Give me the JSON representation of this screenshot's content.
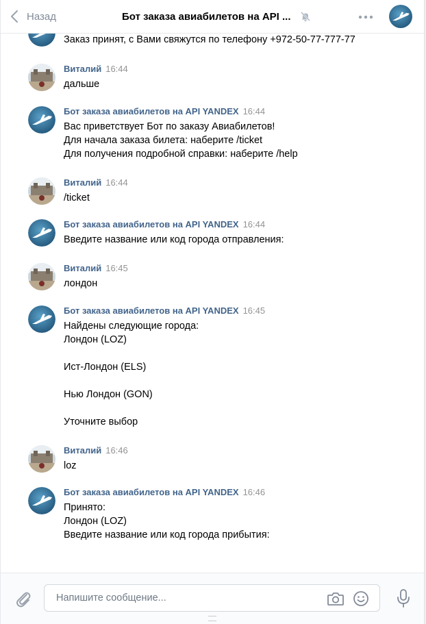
{
  "header": {
    "back_label": "Назад",
    "title": "Бот заказа авиабилетов на API ..."
  },
  "prev_message_tail": "Заказ принят, с Вами свяжутся по телефону +972-50-77-777-77",
  "messages": [
    {
      "author": "Виталий",
      "time": "16:44",
      "text": "дальше",
      "kind": "user"
    },
    {
      "author": "Бот заказа авиабилетов на API YANDEX",
      "time": "16:44",
      "text": "Вас приветствует Бот по заказу Авиабилетов!\nДля начала заказа билета: наберите /ticket\nДля получения подробной справки: наберите /help",
      "kind": "bot"
    },
    {
      "author": "Виталий",
      "time": "16:44",
      "text": "/ticket",
      "kind": "user"
    },
    {
      "author": "Бот заказа авиабилетов на API YANDEX",
      "time": "16:44",
      "text": "Введите название или код города отправления:",
      "kind": "bot"
    },
    {
      "author": "Виталий",
      "time": "16:45",
      "text": "лондон",
      "kind": "user"
    },
    {
      "author": "Бот заказа авиабилетов на API YANDEX",
      "time": "16:45",
      "text": "Найдены следующие города:\nЛондон (LOZ)\n\nИст-Лондон (ELS)\n\nНью Лондон (GON)\n\nУточните выбор",
      "kind": "bot"
    },
    {
      "author": "Виталий",
      "time": "16:46",
      "text": "loz",
      "kind": "user"
    },
    {
      "author": "Бот заказа авиабилетов на API YANDEX",
      "time": "16:46",
      "text": "Принято:\nЛондон (LOZ)\nВведите название или код города прибытия:",
      "kind": "bot"
    }
  ],
  "composer": {
    "placeholder": "Напишите сообщение..."
  },
  "icons": {
    "back": "chevron-left-icon",
    "mute": "muted-bell-icon",
    "more": "more-dots-icon",
    "attach": "paperclip-icon",
    "camera": "camera-icon",
    "emoji": "smile-icon",
    "voice": "microphone-icon"
  },
  "colors": {
    "author": "#42648b",
    "time": "#939393",
    "icon": "#828a99",
    "bot_avatar": "#2f6b93"
  }
}
